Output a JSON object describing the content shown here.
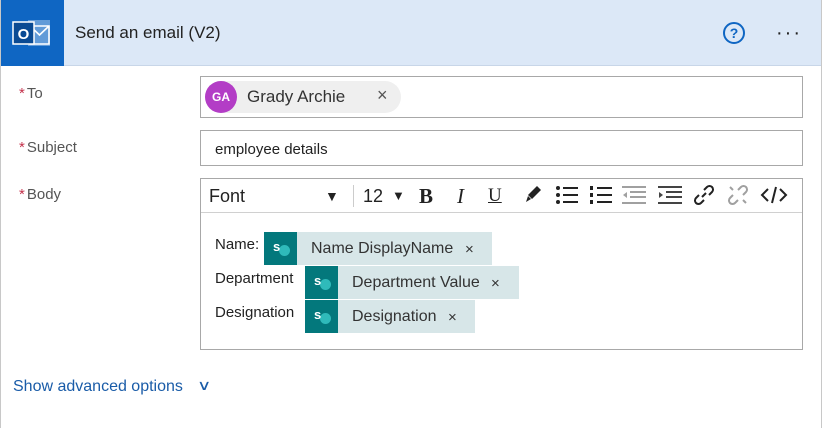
{
  "header": {
    "title": "Send an email (V2)",
    "app_icon": "outlook-icon",
    "help_icon": "question-icon",
    "more_icon": "ellipsis-icon",
    "colors": {
      "header_bg": "#dce8f7",
      "app_tile": "#0f66c3"
    }
  },
  "fields": {
    "to": {
      "required_mark": "*",
      "label": "To",
      "recipient": {
        "initials": "GA",
        "name": "Grady Archie",
        "remove_glyph": "×",
        "avatar_color": "#b33dc6"
      }
    },
    "subject": {
      "required_mark": "*",
      "label": "Subject",
      "value": "employee details"
    },
    "body": {
      "required_mark": "*",
      "label": "Body",
      "toolbar": {
        "font": "Font",
        "font_size": "12",
        "bold": "B",
        "italic": "I",
        "underline": "U",
        "tools": [
          "brush-icon",
          "bullet-list-icon",
          "numbered-list-icon",
          "outdent-icon",
          "indent-icon",
          "link-icon",
          "unlink-icon",
          "code-view-icon"
        ]
      },
      "lines": [
        {
          "prefix": "Name:",
          "token": "Name DisplayName",
          "remove_glyph": "×"
        },
        {
          "prefix": "Department",
          "token": "Department Value",
          "remove_glyph": "×"
        },
        {
          "prefix": "Designation",
          "token": "Designation",
          "remove_glyph": "×"
        }
      ],
      "token_icon_letter": "s",
      "token_color": "#03787c"
    }
  },
  "footer": {
    "advanced_label": "Show advanced options",
    "advanced_icon": "chevron-down-icon"
  }
}
